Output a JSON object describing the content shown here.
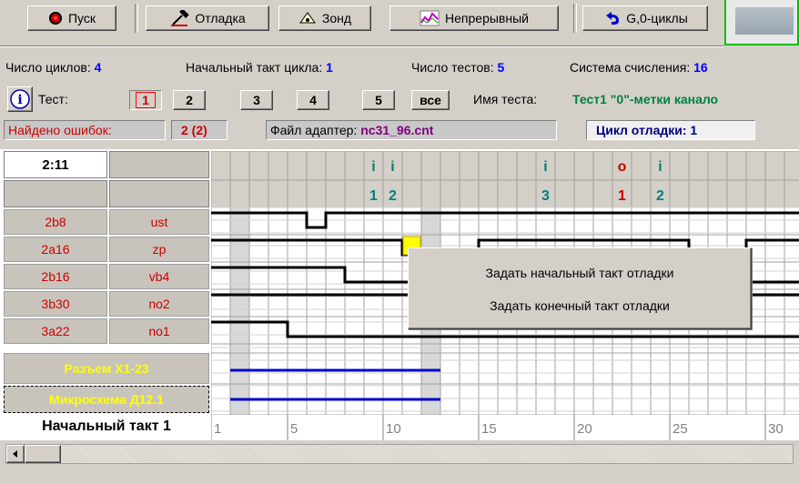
{
  "toolbar": {
    "run_label": "Пуск",
    "debug_label": "Отладка",
    "probe_label": "Зонд",
    "continuous_label": "Непрерывный",
    "cycles_label": "G,0-циклы"
  },
  "info": {
    "cycles_count_label": "Число циклов:",
    "cycles_count_value": "4",
    "start_tact_label": "Начальный такт цикла:",
    "start_tact_value": "1",
    "tests_count_label": "Число тестов:",
    "tests_count_value": "5",
    "numeral_system_label": "Система счисления:",
    "numeral_system_value": "16"
  },
  "tests": {
    "test_label": "Тест:",
    "buttons": [
      "1",
      "2",
      "3",
      "4",
      "5",
      "все"
    ],
    "test_name_label": "Имя теста:",
    "test_name_value": "Тест1 \"0\"-метки канало"
  },
  "status": {
    "errors_label": "Найдено ошибок:",
    "errors_value": "2 (2)",
    "adapter_label": "Файл адаптер:",
    "adapter_value": "nc31_96.cnt",
    "debug_cycle_label": "Цикл отладки: 1"
  },
  "grid": {
    "position": "2:11",
    "signals": [
      {
        "pin": "2b8",
        "name": "ust"
      },
      {
        "pin": "2a16",
        "name": "zp"
      },
      {
        "pin": "2b16",
        "name": "vb4"
      },
      {
        "pin": "3b30",
        "name": "no2"
      },
      {
        "pin": "3a22",
        "name": "no1"
      }
    ],
    "groups": [
      "Разъем X1-23",
      "Микросхема Д12.1"
    ],
    "start_tact_footer": "Начальный такт 1",
    "tick_labels": [
      "1",
      "5",
      "10",
      "15",
      "20",
      "25",
      "30"
    ],
    "markers": [
      {
        "letter": "i",
        "num": "1",
        "col": 8
      },
      {
        "letter": "i",
        "num": "2",
        "col": 9
      },
      {
        "letter": "i",
        "num": "3",
        "col": 17
      },
      {
        "letter": "o",
        "num": "1",
        "col": 21
      },
      {
        "letter": "i",
        "num": "2",
        "col": 23
      }
    ],
    "colors": {
      "marker_i": "#008080",
      "marker_o": "#cc0000",
      "wave": "#000000",
      "group_line": "#0000cc",
      "label_text": "#cc0000",
      "group_text": "#ffff00"
    }
  },
  "context_menu": {
    "item1": "Задать начальный такт отладки",
    "item2": "Задать конечный такт отладки"
  }
}
